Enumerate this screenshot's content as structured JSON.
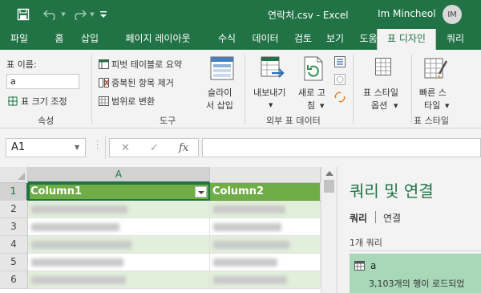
{
  "titlebar": {
    "title": "연락처.csv  -  Excel",
    "user": "Im Mincheol",
    "avatar_initials": "IM",
    "save_icon": "save-icon",
    "undo_icon": "undo-icon",
    "redo_icon": "redo-icon",
    "customize_icon": "customize-toolbar-icon"
  },
  "tabs": [
    "파일",
    "홈",
    "삽입",
    "페이지 레이아웃",
    "수식",
    "데이터",
    "검토",
    "보기",
    "도움말",
    "표 디자인",
    "쿼리"
  ],
  "ribbon": {
    "properties": {
      "name_label": "표 이름:",
      "name_value": "a",
      "resize_label": "표 크기 조정",
      "group_label": "속성"
    },
    "tools": {
      "pivot_label": "피벗 테이블로 요약",
      "dedupe_label": "중복된 항목 제거",
      "convert_label": "범위로 변환",
      "slicer_label_1": "슬라이",
      "slicer_label_2": "서 삽입",
      "group_label": "도구"
    },
    "external": {
      "export_label": "내보내기",
      "refresh_label_1": "새로 고",
      "refresh_label_2": "침",
      "group_label": "외부 표 데이터"
    },
    "style_options": {
      "label_1": "표 스타일",
      "label_2": "옵션"
    },
    "styles": {
      "label_1": "빠른 스",
      "label_2": "타일",
      "group_label": "표 스타일"
    },
    "accent_color": "#217346"
  },
  "formula_bar": {
    "name_box": "A1",
    "cancel_icon": "cancel-icon",
    "enter_icon": "enter-icon",
    "fx_label": "fx",
    "formula": ""
  },
  "grid": {
    "column_a": "A",
    "rows": [
      "1",
      "2",
      "3",
      "4",
      "5",
      "6"
    ],
    "headers": [
      "Column1",
      "Column2"
    ],
    "header_color": "#70ad47",
    "band_color": "#e2efda"
  },
  "queries_pane": {
    "title": "쿼리 및 연결",
    "tab_queries": "쿼리",
    "tab_connections": "연결",
    "count": "1개 쿼리",
    "query_name": "a",
    "query_status": "3,103개의 행이 로드되었"
  }
}
